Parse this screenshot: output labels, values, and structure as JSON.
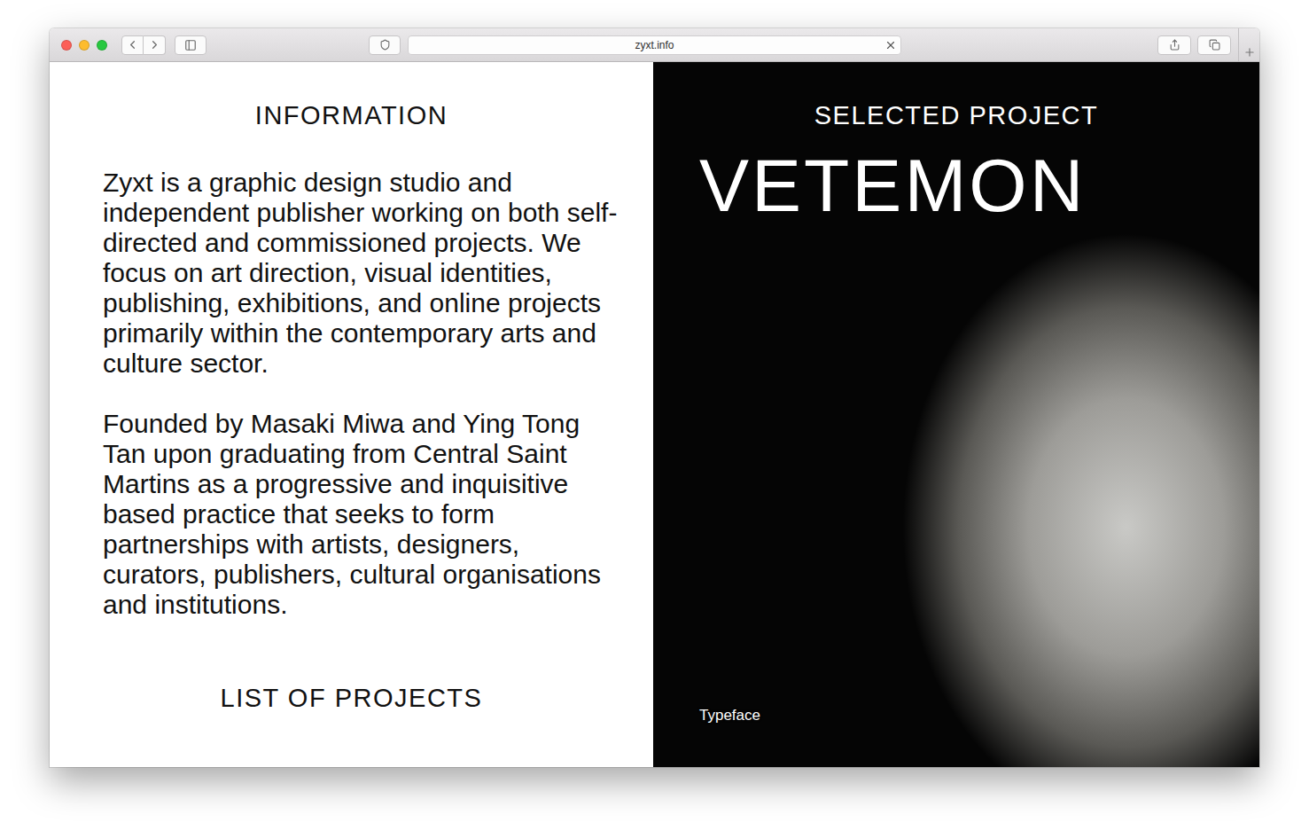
{
  "window": {
    "url": "zyxt.info"
  },
  "information": {
    "heading": "INFORMATION",
    "paragraphs": [
      "Zyxt is a graphic design studio and independent publisher working on both self-directed and commissioned projects. We focus on art direction, visual identities, publishing, exhibitions, and online projects primarily within the contemporary arts and culture sector.",
      "Founded by Masaki Miwa and Ying Tong Tan upon graduating from Central Saint Martins as a progressive and inquisitive based practice that seeks to form partnerships with artists, designers, curators, publishers, cultural organisations and institutions."
    ]
  },
  "list_heading": "LIST OF PROJECTS",
  "selected_project": {
    "heading": "SELECTED PROJECT",
    "title": "VETEMON",
    "category": "Typeface"
  }
}
